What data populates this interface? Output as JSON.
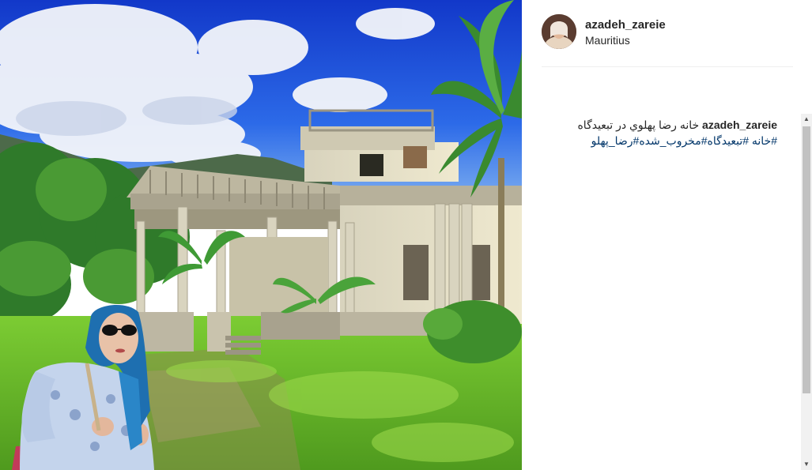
{
  "post": {
    "username": "azadeh_zareie",
    "location": "Mauritius",
    "caption": {
      "username": "azadeh_zareie",
      "text": "خانه رضا پهلوي در تبعيدگاه",
      "tags": [
        "#خانه",
        "#تبعیدگاه",
        "#مخروب_شده",
        "#رضا_پهلو"
      ]
    }
  },
  "icons": {
    "scroll_up": "▲",
    "scroll_down": "▼"
  },
  "colors": {
    "sky": "#1f4fd8",
    "grass": "#6cbf2a",
    "link": "#003569",
    "text": "#262626"
  }
}
